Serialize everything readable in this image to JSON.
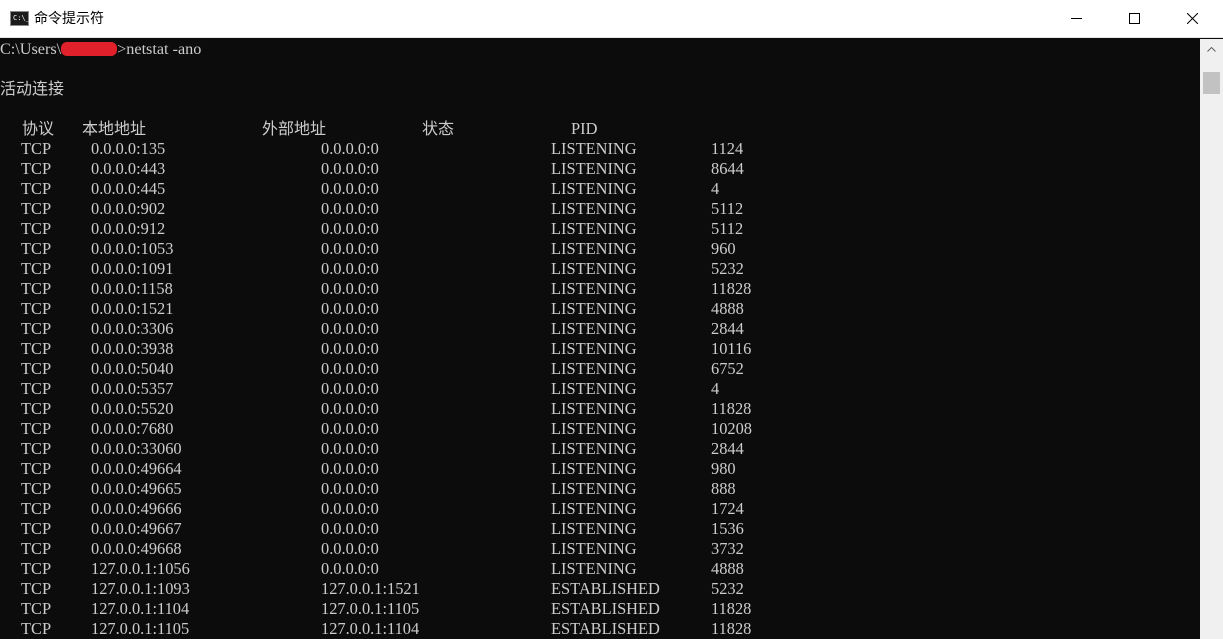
{
  "window": {
    "title": "命令提示符",
    "icon_text": "C:\\_"
  },
  "controls": {
    "minimize": "minimize-icon",
    "maximize": "maximize-icon",
    "close": "close-icon"
  },
  "console": {
    "prompt_prefix": "C:\\Users\\",
    "prompt_suffix": ">netstat -ano",
    "section_title": "活动连接",
    "headers": {
      "proto": "协议",
      "local": "本地地址",
      "foreign": "外部地址",
      "state": "状态",
      "pid": "PID"
    },
    "rows": [
      {
        "proto": "TCP",
        "local": "0.0.0.0:135",
        "foreign": "0.0.0.0:0",
        "state": "LISTENING",
        "pid": "1124"
      },
      {
        "proto": "TCP",
        "local": "0.0.0.0:443",
        "foreign": "0.0.0.0:0",
        "state": "LISTENING",
        "pid": "8644"
      },
      {
        "proto": "TCP",
        "local": "0.0.0.0:445",
        "foreign": "0.0.0.0:0",
        "state": "LISTENING",
        "pid": "4"
      },
      {
        "proto": "TCP",
        "local": "0.0.0.0:902",
        "foreign": "0.0.0.0:0",
        "state": "LISTENING",
        "pid": "5112"
      },
      {
        "proto": "TCP",
        "local": "0.0.0.0:912",
        "foreign": "0.0.0.0:0",
        "state": "LISTENING",
        "pid": "5112"
      },
      {
        "proto": "TCP",
        "local": "0.0.0.0:1053",
        "foreign": "0.0.0.0:0",
        "state": "LISTENING",
        "pid": "960"
      },
      {
        "proto": "TCP",
        "local": "0.0.0.0:1091",
        "foreign": "0.0.0.0:0",
        "state": "LISTENING",
        "pid": "5232"
      },
      {
        "proto": "TCP",
        "local": "0.0.0.0:1158",
        "foreign": "0.0.0.0:0",
        "state": "LISTENING",
        "pid": "11828"
      },
      {
        "proto": "TCP",
        "local": "0.0.0.0:1521",
        "foreign": "0.0.0.0:0",
        "state": "LISTENING",
        "pid": "4888"
      },
      {
        "proto": "TCP",
        "local": "0.0.0.0:3306",
        "foreign": "0.0.0.0:0",
        "state": "LISTENING",
        "pid": "2844"
      },
      {
        "proto": "TCP",
        "local": "0.0.0.0:3938",
        "foreign": "0.0.0.0:0",
        "state": "LISTENING",
        "pid": "10116"
      },
      {
        "proto": "TCP",
        "local": "0.0.0.0:5040",
        "foreign": "0.0.0.0:0",
        "state": "LISTENING",
        "pid": "6752"
      },
      {
        "proto": "TCP",
        "local": "0.0.0.0:5357",
        "foreign": "0.0.0.0:0",
        "state": "LISTENING",
        "pid": "4"
      },
      {
        "proto": "TCP",
        "local": "0.0.0.0:5520",
        "foreign": "0.0.0.0:0",
        "state": "LISTENING",
        "pid": "11828"
      },
      {
        "proto": "TCP",
        "local": "0.0.0.0:7680",
        "foreign": "0.0.0.0:0",
        "state": "LISTENING",
        "pid": "10208"
      },
      {
        "proto": "TCP",
        "local": "0.0.0.0:33060",
        "foreign": "0.0.0.0:0",
        "state": "LISTENING",
        "pid": "2844"
      },
      {
        "proto": "TCP",
        "local": "0.0.0.0:49664",
        "foreign": "0.0.0.0:0",
        "state": "LISTENING",
        "pid": "980"
      },
      {
        "proto": "TCP",
        "local": "0.0.0.0:49665",
        "foreign": "0.0.0.0:0",
        "state": "LISTENING",
        "pid": "888"
      },
      {
        "proto": "TCP",
        "local": "0.0.0.0:49666",
        "foreign": "0.0.0.0:0",
        "state": "LISTENING",
        "pid": "1724"
      },
      {
        "proto": "TCP",
        "local": "0.0.0.0:49667",
        "foreign": "0.0.0.0:0",
        "state": "LISTENING",
        "pid": "1536"
      },
      {
        "proto": "TCP",
        "local": "0.0.0.0:49668",
        "foreign": "0.0.0.0:0",
        "state": "LISTENING",
        "pid": "3732"
      },
      {
        "proto": "TCP",
        "local": "127.0.0.1:1056",
        "foreign": "0.0.0.0:0",
        "state": "LISTENING",
        "pid": "4888"
      },
      {
        "proto": "TCP",
        "local": "127.0.0.1:1093",
        "foreign": "127.0.0.1:1521",
        "state": "ESTABLISHED",
        "pid": "5232"
      },
      {
        "proto": "TCP",
        "local": "127.0.0.1:1104",
        "foreign": "127.0.0.1:1105",
        "state": "ESTABLISHED",
        "pid": "11828"
      },
      {
        "proto": "TCP",
        "local": "127.0.0.1:1105",
        "foreign": "127.0.0.1:1104",
        "state": "ESTABLISHED",
        "pid": "11828"
      }
    ]
  },
  "colors": {
    "console_bg": "#0c0c0c",
    "console_text": "#cccccc",
    "redaction": "#e0202a"
  }
}
